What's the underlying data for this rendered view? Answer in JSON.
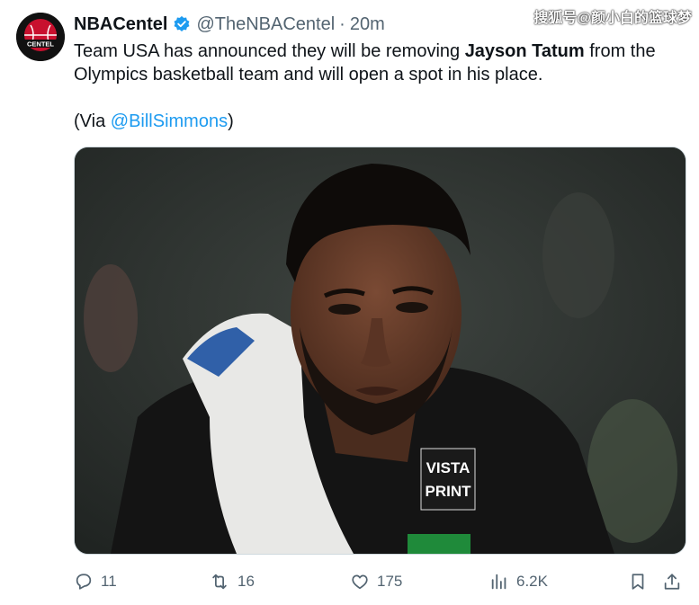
{
  "tweet": {
    "author_name": "NBACentel",
    "author_handle": "@TheNBACentel",
    "separator": "·",
    "time": "20m",
    "avatar_label": "CENTEL",
    "text_parts": {
      "p1_a": "Team USA has announced they will be removing ",
      "p1_bold": "Jayson Tatum",
      "p1_b": " from the Olympics basketball team and will open a spot in his place.",
      "p2_a": "(Via ",
      "p2_mention": "@BillSimmons",
      "p2_b": ")"
    },
    "image_text": {
      "jersey_line1": "VISTA",
      "jersey_line2": "PRINT"
    }
  },
  "actions": {
    "replies": "11",
    "retweets": "16",
    "likes": "175",
    "views": "6.2K"
  },
  "watermark": "搜狐号@颜小白的篮球梦",
  "colors": {
    "accent": "#1d9bf0",
    "secondary_text": "#536471",
    "verified": "#1d9bf0"
  },
  "icons": [
    "reply-icon",
    "retweet-icon",
    "like-icon",
    "views-icon",
    "bookmark-icon",
    "share-icon",
    "verified-badge-icon"
  ]
}
